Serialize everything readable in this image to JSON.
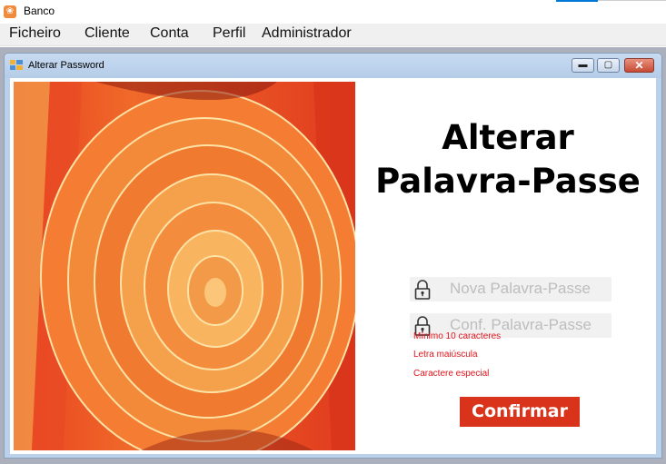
{
  "app": {
    "title": "Banco",
    "icon": "app-icon"
  },
  "menu": {
    "items": [
      "Ficheiro",
      "Cliente",
      "Conta",
      "Perfil",
      "Administrador"
    ]
  },
  "window": {
    "title": "Alterar Password",
    "controls": [
      "minimize-icon",
      "maximize-icon",
      "close-icon"
    ]
  },
  "form": {
    "heading_line1": "Alterar",
    "heading_line2": "Palavra-Passe",
    "new_password_placeholder": "Nova Palavra-Passe",
    "confirm_password_placeholder": "Conf. Palavra-Passe",
    "rules": [
      "Mínimo 10 caracteres",
      "Letra maiúscula",
      "Caractere especial"
    ],
    "confirm_label": "Confirmar"
  },
  "colors": {
    "accent": "#d9341b",
    "rule_text": "#e0141b",
    "mdi_background": "#abb0bc"
  }
}
